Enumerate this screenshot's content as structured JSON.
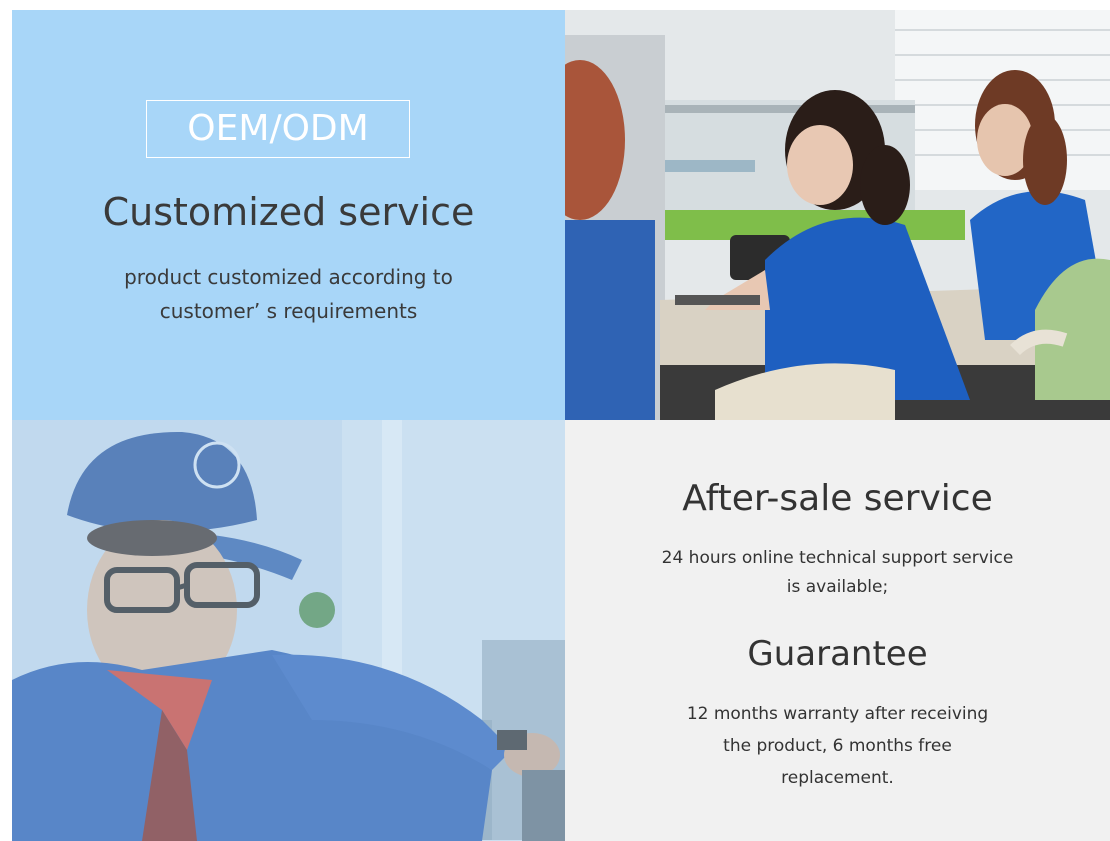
{
  "custom": {
    "badge": "OEM/ODM",
    "title": "Customized service",
    "subtitle_lines": [
      "product customized according to",
      "customer’ s requirements"
    ]
  },
  "after_sale": {
    "title": "After-sale service",
    "subtitle_lines": [
      "24 hours online technical support service",
      "is available;"
    ]
  },
  "guarantee": {
    "title": "Guarantee",
    "subtitle_lines": [
      "12 months warranty after receiving",
      "the product, 6 months free",
      "replacement."
    ]
  },
  "colors": {
    "panel_blue": "#a8d6f8",
    "panel_grey": "#f1f1f1",
    "shirt_blue": "#1e5fc0"
  }
}
